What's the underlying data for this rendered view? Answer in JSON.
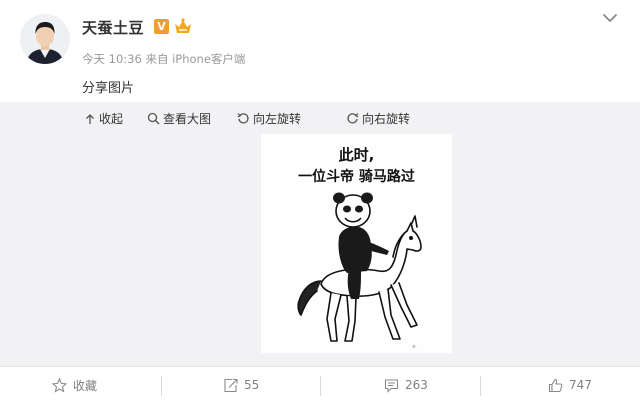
{
  "post": {
    "username": "天蚕土豆",
    "verified_badge": "V",
    "meta": "今天 10:36 来自 iPhone客户端",
    "text": "分享图片"
  },
  "toolbar": {
    "collapse_label": "收起",
    "view_large_label": "查看大图",
    "rotate_left_label": "向左旋转",
    "rotate_right_label": "向右旋转"
  },
  "image": {
    "line1": "此时,",
    "line2": "一位斗帝 骑马路过"
  },
  "actions": {
    "favorite_label": "收藏",
    "repost_count": "55",
    "comment_count": "263",
    "like_count": "747"
  },
  "colors": {
    "verified": "#f19e2e",
    "media_background": "#f2f2f5",
    "muted_text": "#808080"
  }
}
